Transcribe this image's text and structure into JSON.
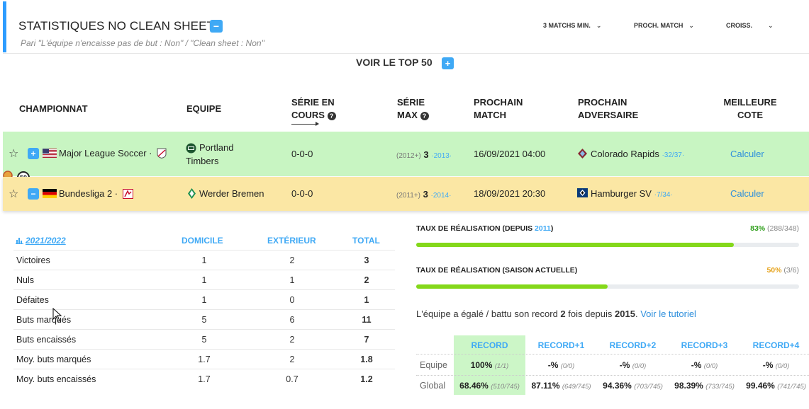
{
  "header": {
    "title": "STATISTIQUES NO CLEAN SHEET",
    "subtitle": "Pari \"L'équipe n'encaisse pas de but : Non\" / \"Clean sheet : Non\"",
    "filters": [
      "3 MATCHS MIN.",
      "PROCH. MATCH",
      "CROISS."
    ]
  },
  "top50": {
    "label": "VOIR LE TOP 50"
  },
  "columns": {
    "championnat": "CHAMPIONNAT",
    "equipe": "EQUIPE",
    "serie_en_cours_1": "SÉRIE EN",
    "serie_en_cours_2": "COURS",
    "serie_max_1": "SÉRIE",
    "serie_max_2": "MAX",
    "prochain_match_1": "PROCHAIN",
    "prochain_match_2": "MATCH",
    "prochain_adv_1": "PROCHAIN",
    "prochain_adv_2": "ADVERSAIRE",
    "meilleure_cote_1": "MEILLEURE",
    "meilleure_cote_2": "COTE"
  },
  "rows": [
    {
      "league": "Major League Soccer ·",
      "team_line1": "Portland",
      "team_line2": "Timbers",
      "current": "0-0-0",
      "max_prefix": "(2012+)",
      "max_value": "3",
      "max_suffix": "·2013·",
      "next_match": "16/09/2021 04:00",
      "opponent": "Colorado Rapids",
      "opponent_rank": "·32/37·",
      "odds": "Calculer",
      "toggle": "+"
    },
    {
      "league": "Bundesliga 2 ·",
      "team": "Werder Bremen",
      "current": "0-0-0",
      "max_prefix": "(2011+)",
      "max_value": "3",
      "max_suffix": "·2014·",
      "next_match": "18/09/2021 20:30",
      "opponent": "Hamburger SV",
      "opponent_rank": "·7/34·",
      "odds": "Calculer",
      "toggle": "−",
      "badge": "50"
    }
  ],
  "stats": {
    "season": "2021/2022",
    "headers": [
      "DOMICILE",
      "EXTÉRIEUR",
      "TOTAL"
    ],
    "rows": [
      {
        "label": "Victoires",
        "home": "1",
        "away": "2",
        "total": "3"
      },
      {
        "label": "Nuls",
        "home": "1",
        "away": "1",
        "total": "2"
      },
      {
        "label": "Défaites",
        "home": "1",
        "away": "0",
        "total": "1"
      },
      {
        "label": "Buts marqués",
        "home": "5",
        "away": "6",
        "total": "11"
      },
      {
        "label": "Buts encaissés",
        "home": "5",
        "away": "2",
        "total": "7"
      },
      {
        "label": "Moy. buts marqués",
        "home": "1.7",
        "away": "2",
        "total": "1.8"
      },
      {
        "label": "Moy. buts encaissés",
        "home": "1.7",
        "away": "0.7",
        "total": "1.2"
      }
    ]
  },
  "rates": {
    "since_label_pre": "TAUX DE RÉALISATION (DEPUIS ",
    "since_year": "2011",
    "since_label_post": ")",
    "since_pct": "83%",
    "since_frac": "(288/348)",
    "since_value": 0.83,
    "season_label": "TAUX DE RÉALISATION (SAISON ACTUELLE)",
    "season_pct": "50%",
    "season_frac": "(3/6)",
    "season_value": 0.5
  },
  "record": {
    "text_pre": "L'équipe a égalé / battu son record ",
    "count": "2",
    "text_mid": " fois depuis ",
    "year": "2015",
    "text_post": ".",
    "link": "Voir le tutoriel",
    "headers": [
      "RECORD",
      "RECORD+1",
      "RECORD+2",
      "RECORD+3",
      "RECORD+4"
    ],
    "row_equipe_label": "Equipe",
    "row_global_label": "Global",
    "equipe": [
      {
        "pct": "100%",
        "frac": "(1/1)"
      },
      {
        "pct": "-%",
        "frac": "(0/0)"
      },
      {
        "pct": "-%",
        "frac": "(0/0)"
      },
      {
        "pct": "-%",
        "frac": "(0/0)"
      },
      {
        "pct": "-%",
        "frac": "(0/0)"
      }
    ],
    "global": [
      {
        "pct": "68.46%",
        "frac": "(510/745)"
      },
      {
        "pct": "87.11%",
        "frac": "(649/745)"
      },
      {
        "pct": "94.36%",
        "frac": "(703/745)"
      },
      {
        "pct": "98.39%",
        "frac": "(733/745)"
      },
      {
        "pct": "99.46%",
        "frac": "(741/745)"
      }
    ]
  },
  "colors": {
    "accent": "#3fa9f5",
    "row_green": "#c8f5c2",
    "row_yellow": "#fbe7a4",
    "bar_fill": "#84d81a",
    "pct_green": "#2e9e1a",
    "pct_orange": "#e6a21a"
  }
}
